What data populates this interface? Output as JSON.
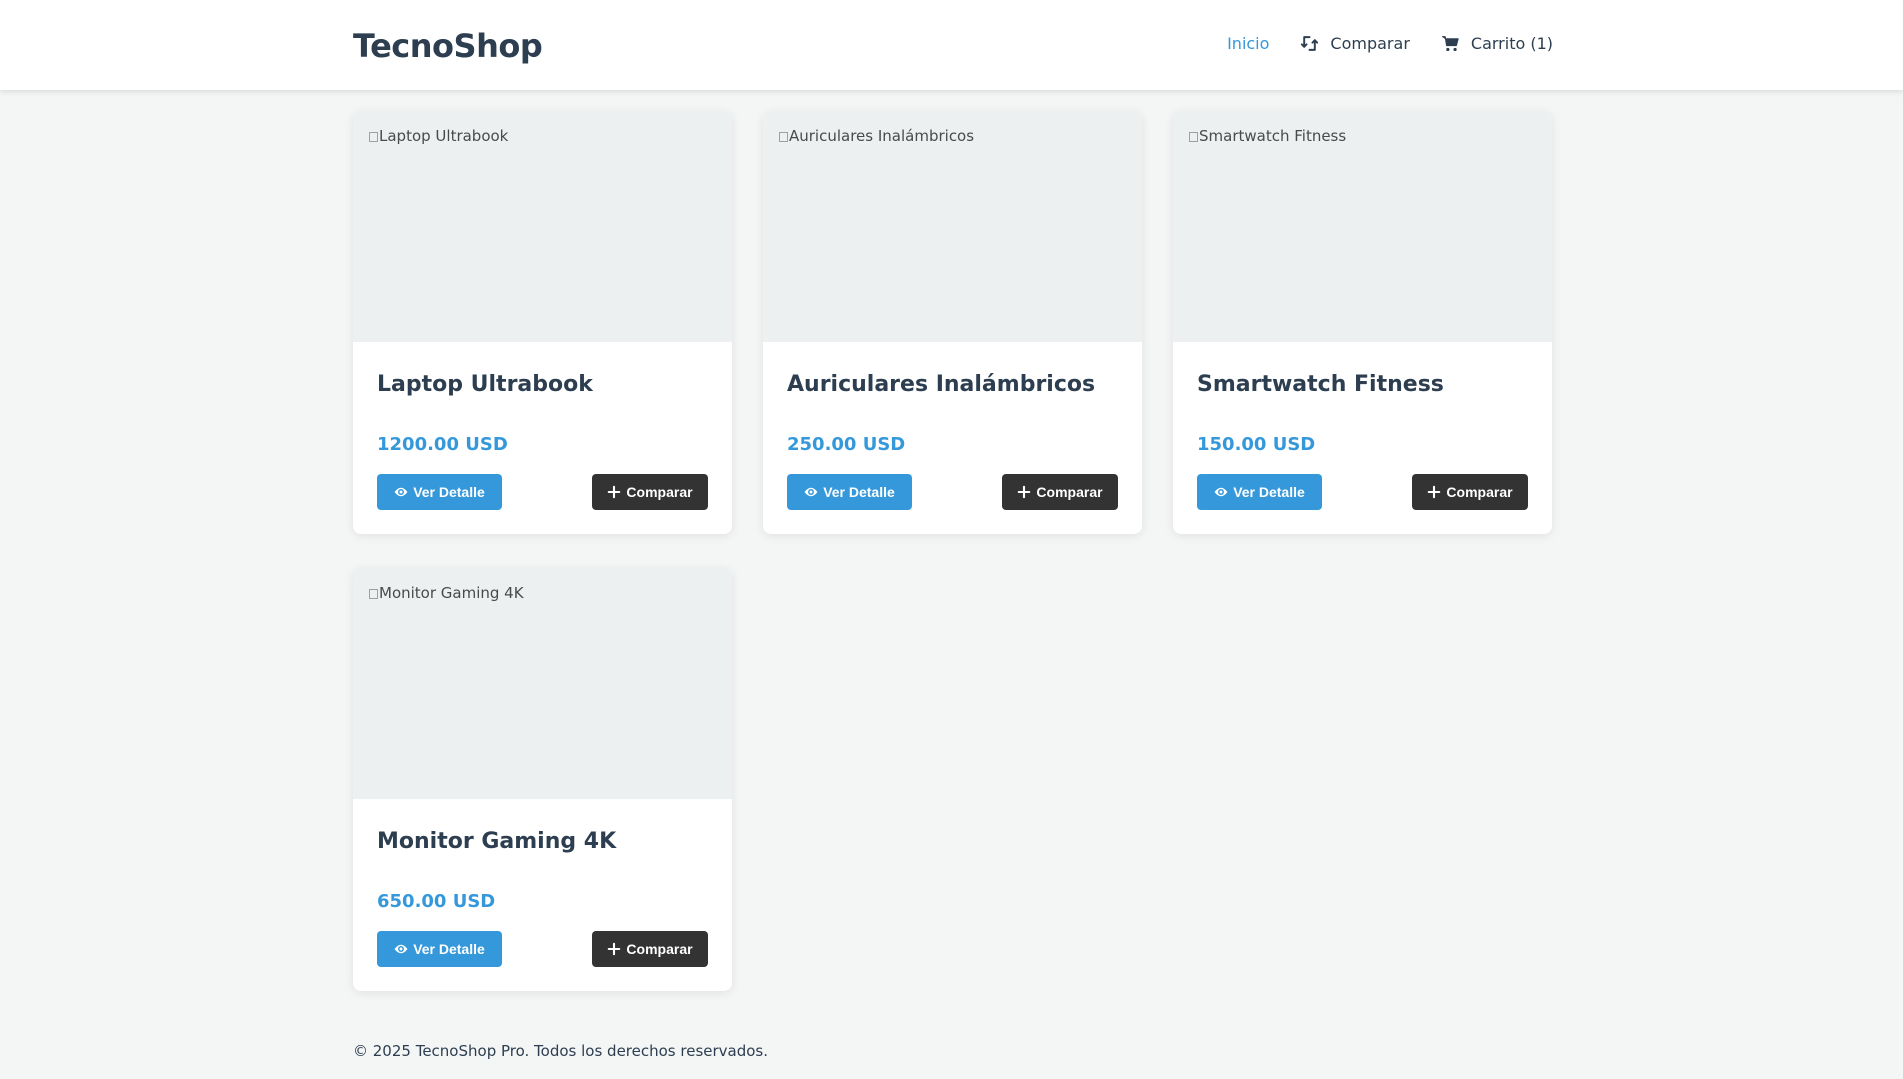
{
  "header": {
    "logo": "TecnoShop",
    "nav": {
      "home": "Inicio",
      "compare": "Comparar",
      "cart": "Carrito (1)"
    },
    "active_color": "#3498db"
  },
  "products": [
    {
      "image_alt": "Laptop Ultrabook",
      "name": "Laptop Ultrabook",
      "price": "1200.00 USD"
    },
    {
      "image_alt": "Auriculares Inalámbricos",
      "name": "Auriculares Inalámbricos",
      "price": "250.00 USD"
    },
    {
      "image_alt": "Smartwatch Fitness",
      "name": "Smartwatch Fitness",
      "price": "150.00 USD"
    },
    {
      "image_alt": "Monitor Gaming 4K",
      "name": "Monitor Gaming 4K",
      "price": "650.00 USD"
    }
  ],
  "buttons": {
    "detail_label": "Ver Detalle",
    "compare_label": "Comparar",
    "detail_icon": "eye-icon",
    "compare_icon": "plus-icon"
  },
  "footer": {
    "text": "© 2025 TecnoShop Pro. Todos los derechos reservados."
  },
  "colors": {
    "primary": "#3498db",
    "dark": "#333333",
    "text": "#2c3e50",
    "background": "#f4f5f5"
  }
}
